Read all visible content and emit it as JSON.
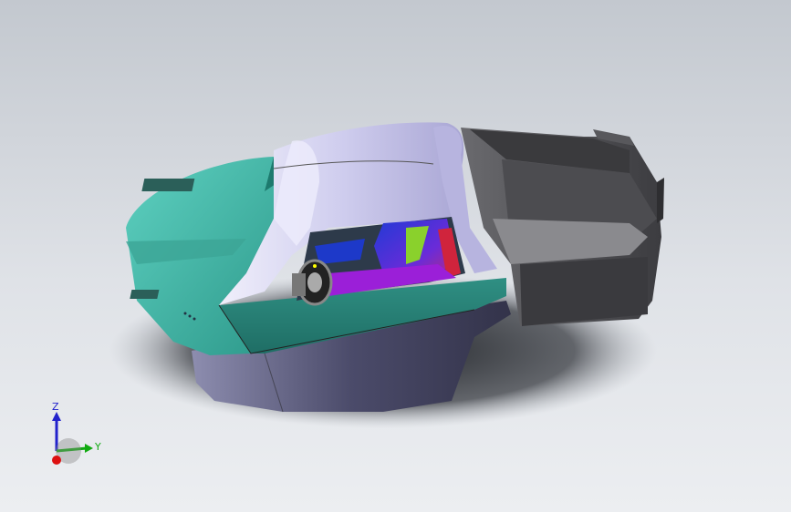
{
  "triad": {
    "z_label": "Z",
    "y_label": "Y"
  },
  "colors": {
    "background_top": "#c3c8cf",
    "background_bottom": "#eceef1",
    "shell_teal": "#3fb5a6",
    "canopy_lavender": "#d6d4f0",
    "hull_dark": "#4a4a68",
    "rear_pod": "#5f5f62",
    "seat_blue": "#1f3bd6",
    "seat_purple": "#9b1fd8",
    "seat_red": "#d0243c",
    "seat_green": "#8ad12c",
    "axis_x": "#d11",
    "axis_y": "#1a1",
    "axis_z": "#22c"
  }
}
